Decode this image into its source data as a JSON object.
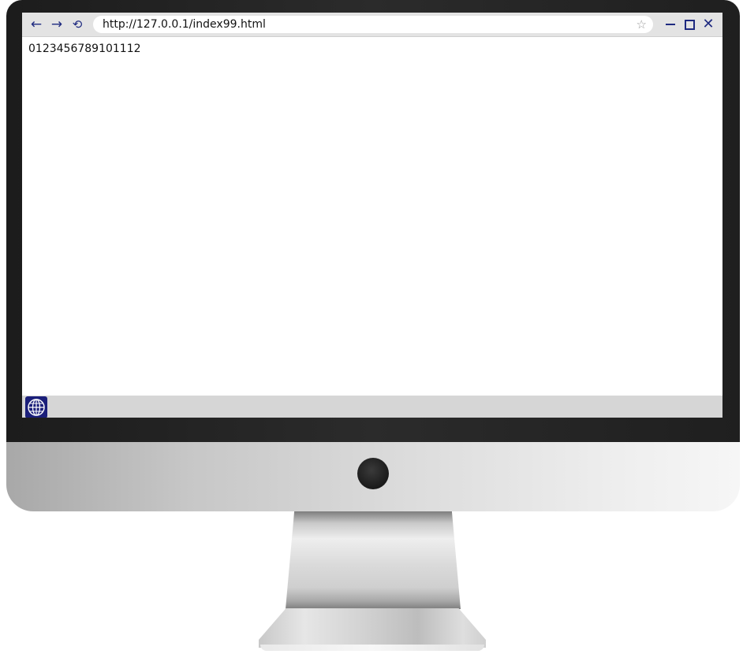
{
  "browser": {
    "nav": {
      "back_icon": "←",
      "forward_icon": "→",
      "reload_icon": "⟲"
    },
    "url": "http://127.0.0.1/index99.html",
    "bookmark_icon": "☆",
    "window_controls": {
      "close_icon": "✕"
    }
  },
  "page": {
    "text": "0123456789101112"
  },
  "taskbar": {
    "apps": [
      {
        "icon": "globe-icon",
        "name": "browser"
      }
    ]
  },
  "colors": {
    "accent": "#1e2a80",
    "taskbar_bg": "#d6d6d6",
    "titlebar_bg": "#e3e3e3",
    "bezel": "#222222"
  }
}
